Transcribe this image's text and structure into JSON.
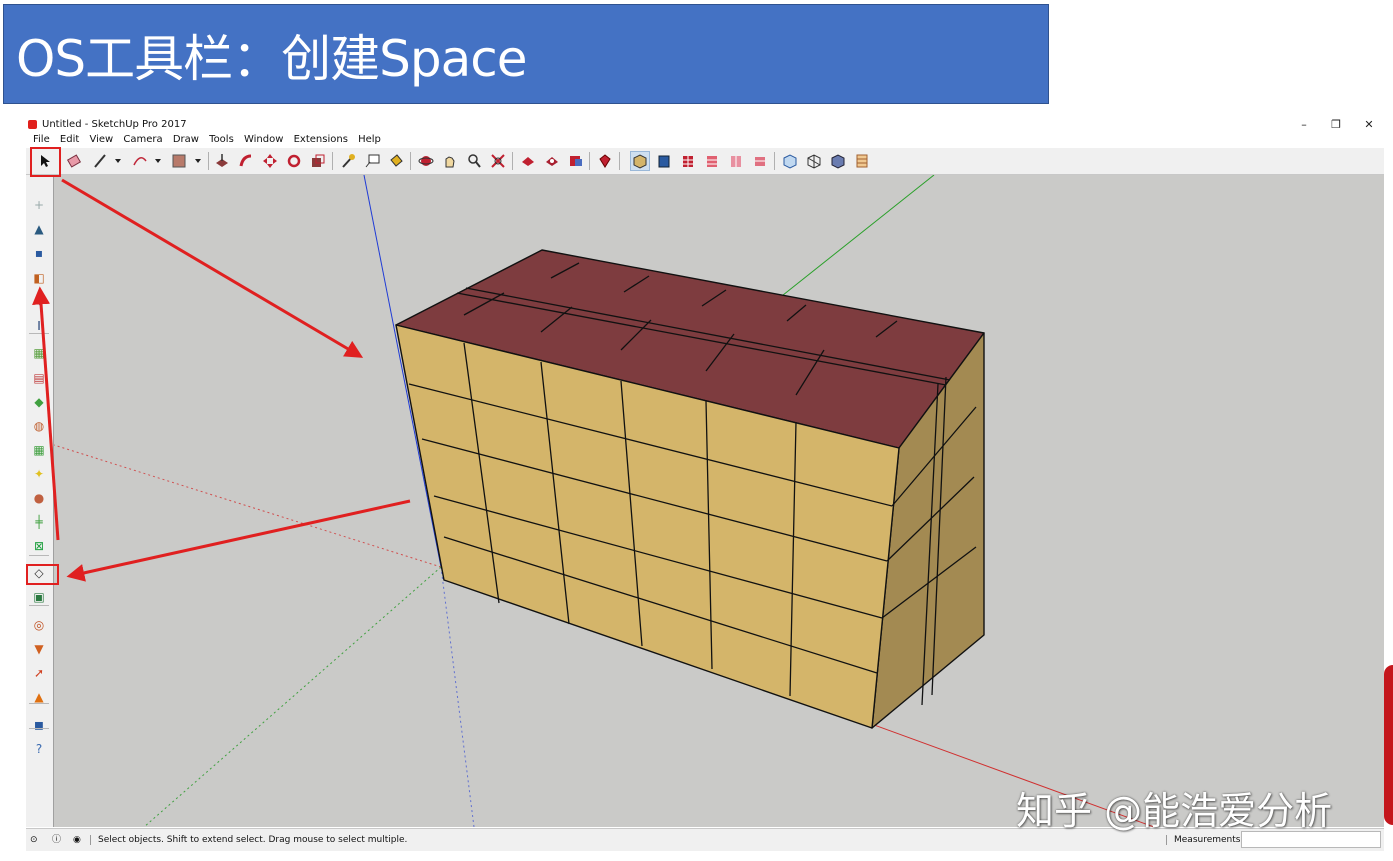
{
  "slide": {
    "title": "OS工具栏：创建Space"
  },
  "window": {
    "title": "Untitled - SketchUp Pro 2017",
    "controls": {
      "minimize": "–",
      "restore": "❐",
      "close": "✕"
    }
  },
  "menu": [
    "File",
    "Edit",
    "View",
    "Camera",
    "Draw",
    "Tools",
    "Window",
    "Extensions",
    "Help"
  ],
  "toolbar_icons": [
    "select-icon",
    "eraser-icon",
    "pencil-icon",
    "arc-icon",
    "rectangle-icon",
    "push-pull-icon",
    "follow-me-icon",
    "move-icon",
    "rotate-icon",
    "scale-icon",
    "tape-measure-icon",
    "text-icon",
    "paint-bucket-icon",
    "orbit-icon",
    "pan-icon",
    "zoom-icon",
    "zoom-extents-icon",
    "warehouse-icon",
    "extension-warehouse-icon",
    "layout-icon",
    "ruby-icon",
    "iso-view-icon",
    "top-view-icon",
    "front-view-icon",
    "right-view-icon",
    "back-view-icon",
    "left-view-icon",
    "xray-icon",
    "wireframe-icon",
    "hidden-line-icon",
    "shaded-icon"
  ],
  "sidebar_icons": [
    "new-model-icon",
    "open-icon",
    "save-icon",
    "save-as-icon",
    "import-icon",
    "idf-icon",
    "new-space-type-icon",
    "new-building-icon",
    "new-thermal-zone-icon",
    "new-construction-icon",
    "new-schedule-icon",
    "new-light-icon",
    "new-loads-icon",
    "surface-matching-icon",
    "render-icon",
    "create-space-icon",
    "project-loose-geometry-icon",
    "inspector-icon",
    "filter-icon",
    "select-icon",
    "warning-icon",
    "model-info-icon",
    "help-icon"
  ],
  "status": {
    "text": "Select objects. Shift to extend select. Drag mouse to select multiple.",
    "measurements_label": "Measurements",
    "measurements_value": ""
  },
  "watermark": "知乎 @能浩爱分析",
  "colors": {
    "banner": "#4472c4",
    "roof": "#7e3c3f",
    "wall": "#d4b56a",
    "highlight": "#e02020"
  }
}
